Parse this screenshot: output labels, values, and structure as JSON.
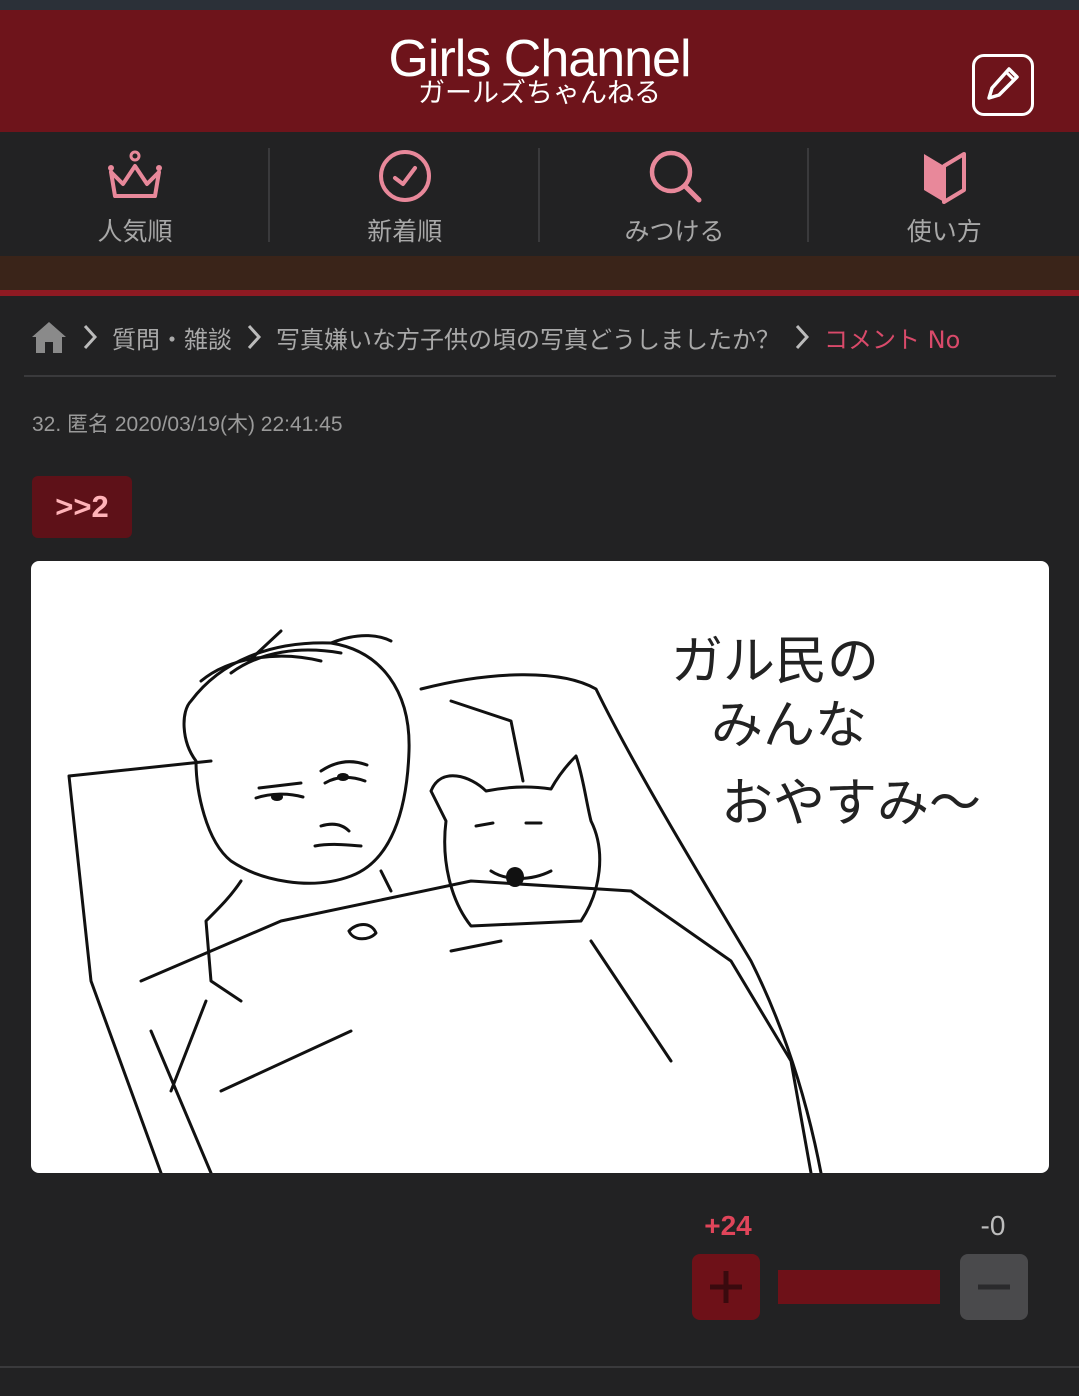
{
  "header": {
    "logo_en": "Girls Channel",
    "logo_ja": "ガールズちゃんねる",
    "post_icon": "compose-icon"
  },
  "nav": {
    "items": [
      {
        "label": "人気順",
        "icon": "crown-icon"
      },
      {
        "label": "新着順",
        "icon": "clock-icon"
      },
      {
        "label": "みつける",
        "icon": "search-icon"
      },
      {
        "label": "使い方",
        "icon": "beginner-mark-icon"
      }
    ]
  },
  "breadcrumb": {
    "home_icon": "home-icon",
    "items": [
      "質問・雑談",
      "写真嫌いな方子供の頃の写真どうしましたか？",
      "コメント No"
    ]
  },
  "comment": {
    "meta": "32. 匿名 2020/03/19(木) 22:41:45",
    "anchor": ">>2",
    "drawing_text": [
      "ガル民の",
      "みんな",
      "おやすみ〜"
    ],
    "votes": {
      "plus": "+24",
      "minus": "-0",
      "plus_ratio": 1.0
    }
  },
  "colors": {
    "header_bg": "#6e141b",
    "accent": "#d94a6a",
    "plus": "#e0455a"
  }
}
